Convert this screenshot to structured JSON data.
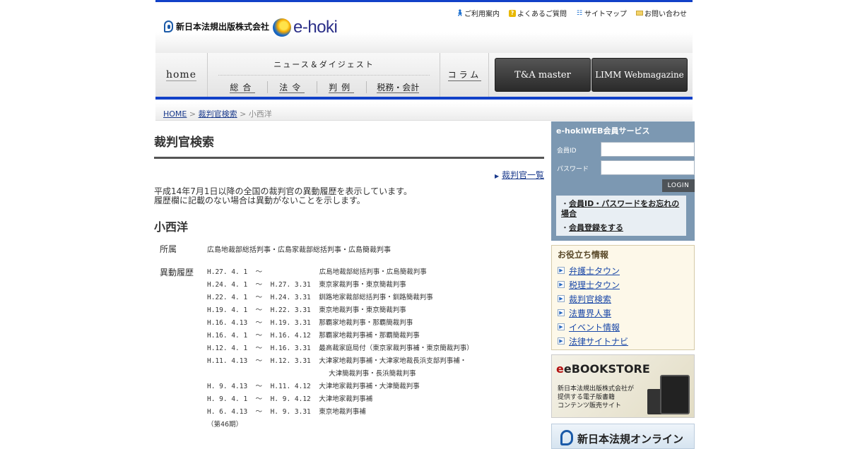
{
  "header": {
    "corp_name": "新日本法規出版株式会社",
    "site_logo": "e-hoki",
    "util_links": [
      {
        "label": "ご利用案内",
        "icon": "person-icon"
      },
      {
        "label": "よくあるご質問",
        "icon": "question-icon"
      },
      {
        "label": "サイトマップ",
        "icon": "sitemap-icon"
      },
      {
        "label": "お問い合わせ",
        "icon": "mail-icon"
      }
    ]
  },
  "nav": {
    "home": "home",
    "news_heading": "ニュース＆ダイジェスト",
    "news_subs": [
      "総合",
      "法令",
      "判例",
      "税務・会計"
    ],
    "column": "コラム",
    "ta_master": "T&A master",
    "limm": "LIMM Webmagazine"
  },
  "breadcrumb": {
    "home": "HOME",
    "sep": ">",
    "search": "裁判官検索",
    "current": "小西洋"
  },
  "main": {
    "title": "裁判官検索",
    "list_link": "裁判官一覧",
    "desc_line1": "平成14年7月1日以降の全国の裁判官の異動履歴を表示しています。",
    "desc_line2": "履歴欄に記載のない場合は異動がないことを示します。",
    "judge_name": "小西洋",
    "affiliation_label": "所属",
    "affiliation": "広島地裁部総括判事・広島家裁部総括判事・広島簡裁判事",
    "history_label": "異動履歴",
    "history": [
      {
        "period": "H.27. 4. 1  ～            ",
        "position": "広島地裁部総括判事・広島簡裁判事",
        "indent": true
      },
      {
        "period": "H.24. 4. 1  ～  H.27. 3.31  ",
        "position": "東京家裁判事・東京簡裁判事"
      },
      {
        "period": "H.22. 4. 1  ～  H.24. 3.31  ",
        "position": "釧路地家裁部総括判事・釧路簡裁判事"
      },
      {
        "period": "H.19. 4. 1  ～  H.22. 3.31  ",
        "position": "東京地裁判事・東京簡裁判事"
      },
      {
        "period": "H.16. 4.13  ～  H.19. 3.31  ",
        "position": "那覇家地裁判事・那覇簡裁判事"
      },
      {
        "period": "H.16. 4. 1  ～  H.16. 4.12  ",
        "position": "那覇家地裁判事補・那覇簡裁判事"
      },
      {
        "period": "H.12. 4. 1  ～  H.16. 3.31  ",
        "position": "最高裁家庭局付（東京家裁判事補・東京簡裁判事）"
      },
      {
        "period": "H.11. 4.13  ～  H.12. 3.31  ",
        "position": "大津家地裁判事補・大津家地裁長浜支部判事補・"
      },
      {
        "period": "                            ",
        "position": "大津簡裁判事・長浜簡裁判事",
        "indent": true
      },
      {
        "period": "H. 9. 4.13  ～  H.11. 4.12  ",
        "position": "大津地家裁判事補・大津簡裁判事"
      },
      {
        "period": "H. 9. 4. 1  ～  H. 9. 4.12  ",
        "position": "大津地家裁判事補"
      },
      {
        "period": "H. 6. 4.13  ～  H. 9. 3.31  ",
        "position": "東京地裁判事補"
      }
    ],
    "term": "（第46期）"
  },
  "sidebar": {
    "member_title": "e-hokiWEB会員サービス",
    "id_label": "会員ID",
    "pw_label": "パスワード",
    "login": "LOGIN",
    "forgot_link": "会員ID・パスワードをお忘れの場合",
    "register_link": "会員登録をする",
    "useful_title": "お役立ち情報",
    "useful_items": [
      "弁護士タウン",
      "税理士タウン",
      "裁判官検索",
      "法曹界人事",
      "イベント情報",
      "法律サイトナビ"
    ],
    "ebook_brand": "eBOOKSTORE",
    "ebook_lines": [
      "新日本法規出版株式会社が",
      "提供する電子版書籍",
      "コンテンツ販売サイト"
    ],
    "online_label": "新日本法規オンライン"
  }
}
